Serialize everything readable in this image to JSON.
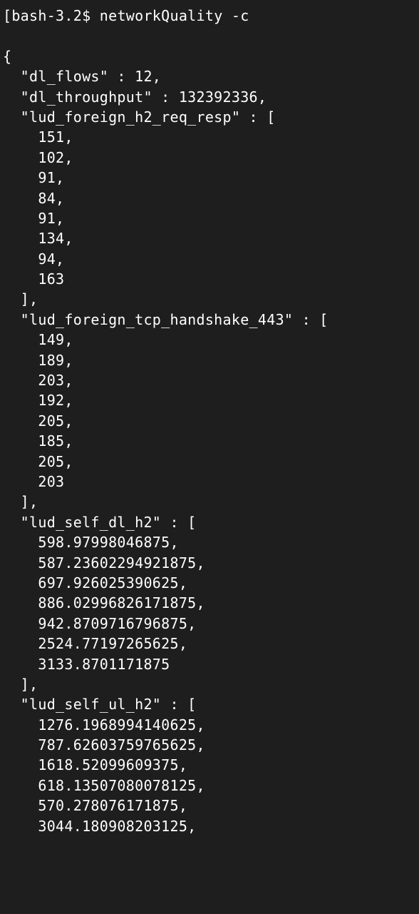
{
  "prompt": {
    "bracket_open": "[",
    "shell": "bash-3.2$",
    "command": "networkQuality -c"
  },
  "output": {
    "lines": [
      "{",
      "  \"dl_flows\" : 12,",
      "  \"dl_throughput\" : 132392336,",
      "  \"lud_foreign_h2_req_resp\" : [",
      "    151,",
      "    102,",
      "    91,",
      "    84,",
      "    91,",
      "    134,",
      "    94,",
      "    163",
      "  ],",
      "  \"lud_foreign_tcp_handshake_443\" : [",
      "    149,",
      "    189,",
      "    203,",
      "    192,",
      "    205,",
      "    185,",
      "    205,",
      "    203",
      "  ],",
      "  \"lud_self_dl_h2\" : [",
      "    598.97998046875,",
      "    587.23602294921875,",
      "    697.926025390625,",
      "    886.02996826171875,",
      "    942.8709716796875,",
      "    2524.77197265625,",
      "    3133.8701171875",
      "  ],",
      "  \"lud_self_ul_h2\" : [",
      "    1276.1968994140625,",
      "    787.62603759765625,",
      "    1618.52099609375,",
      "    618.13507080078125,",
      "    570.278076171875,",
      "    3044.180908203125,"
    ]
  },
  "json_data": {
    "dl_flows": 12,
    "dl_throughput": 132392336,
    "lud_foreign_h2_req_resp": [
      151,
      102,
      91,
      84,
      91,
      134,
      94,
      163
    ],
    "lud_foreign_tcp_handshake_443": [
      149,
      189,
      203,
      192,
      205,
      185,
      205,
      203
    ],
    "lud_self_dl_h2": [
      598.97998046875,
      587.2360229492188,
      697.926025390625,
      886.0299682617188,
      942.8709716796875,
      2524.77197265625,
      3133.8701171875
    ],
    "lud_self_ul_h2": [
      1276.1968994140625,
      787.6260375976562,
      1618.52099609375,
      618.1350708007812,
      570.278076171875,
      3044.180908203125
    ]
  }
}
